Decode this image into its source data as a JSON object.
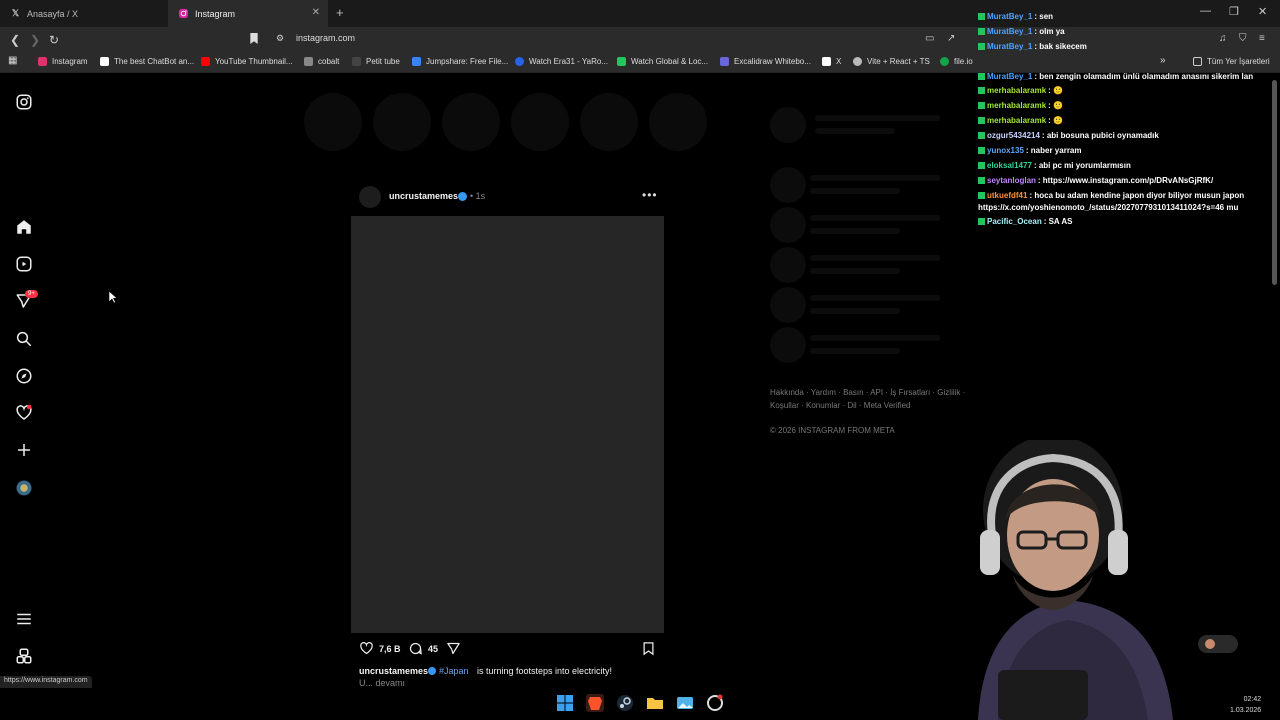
{
  "browser": {
    "tabs": [
      {
        "title": "Anasayfa / X",
        "icon": "x-logo-icon"
      },
      {
        "title": "Instagram",
        "icon": "instagram-icon",
        "active": true
      }
    ],
    "url": "instagram.com",
    "bookmarks": [
      {
        "label": "Instagram",
        "color": "#e1306c"
      },
      {
        "label": "The best ChatBot an...",
        "color": "#ffffff"
      },
      {
        "label": "YouTube Thumbnail...",
        "color": "#ff0000"
      },
      {
        "label": "cobalt",
        "color": "#888888"
      },
      {
        "label": "Petit tube",
        "color": "#444444"
      },
      {
        "label": "Jumpshare: Free File...",
        "color": "#3b82f6"
      },
      {
        "label": "Watch Era31 - YaRo...",
        "color": "#2563eb"
      },
      {
        "label": "Watch Global & Loc...",
        "color": "#22c55e"
      },
      {
        "label": "Excalidraw Whitebo...",
        "color": "#6965db"
      },
      {
        "label": "X",
        "color": "#ffffff"
      },
      {
        "label": "Vite + React + TS",
        "color": "#bbbbbb"
      },
      {
        "label": "file.io",
        "color": "#16a34a"
      }
    ],
    "all_bookmarks": "Tüm Yer İşaretleri",
    "status_url": "https://www.instagram.com"
  },
  "post": {
    "username": "uncrustamemes",
    "time": "1s",
    "likes": "7,6 B",
    "comments": "45",
    "caption_user": "uncrustamemes",
    "caption_tag": "#Japan",
    "caption_text": "is turning footsteps into electricity!",
    "caption_more": "U... devamı"
  },
  "footer": {
    "links_line1": "Hakkında · Yardım · Basın · API · İş Fırsatları · Gizlilik ·",
    "links_line2": "Koşullar · Konumlar · Dil · Meta Verified",
    "copyright": "© 2026 INSTAGRAM FROM META"
  },
  "chat": [
    {
      "user": "MuratBey_1",
      "color": "#4aa3ff",
      "msg": "sen"
    },
    {
      "user": "MuratBey_1",
      "color": "#4aa3ff",
      "msg": "olm ya"
    },
    {
      "user": "MuratBey_1",
      "color": "#4aa3ff",
      "msg": "bak sikecem"
    },
    {
      "user": "MuratBey_1",
      "color": "#4aa3ff",
      "msg": "ben zengin olamadım ünlü olamadım anasını sikerim lan"
    },
    {
      "user": "merhabalaramk",
      "color": "#a3e635",
      "msg": "🙂"
    },
    {
      "user": "merhabalaramk",
      "color": "#a3e635",
      "msg": "🙂"
    },
    {
      "user": "merhabalaramk",
      "color": "#a3e635",
      "msg": "🙂"
    },
    {
      "user": "ozgur5434214",
      "color": "#c7d2fe",
      "msg": "abi bosuna pubici oynamadık"
    },
    {
      "user": "yunox135",
      "color": "#60a5fa",
      "msg": "naber yarram"
    },
    {
      "user": "eloksal1477",
      "color": "#34d399",
      "msg": "abi pc mi yorumlarmısın"
    },
    {
      "user": "seytanloglan",
      "color": "#c084fc",
      "msg": "https://www.instagram.com/p/DRvANsGjRfK/"
    },
    {
      "user": "utkuefdf41",
      "color": "#fb923c",
      "msg": "hoca bu adam kendine japon diyor biliyor musun japon https://x.com/yoshienomoto_/status/2027077931013411024?s=46 mu"
    },
    {
      "user": "Pacific_Ocean",
      "color": "#a5f3fc",
      "msg": "SA AS"
    }
  ],
  "clock": {
    "time": "02:42",
    "date": "1.03.2026"
  }
}
